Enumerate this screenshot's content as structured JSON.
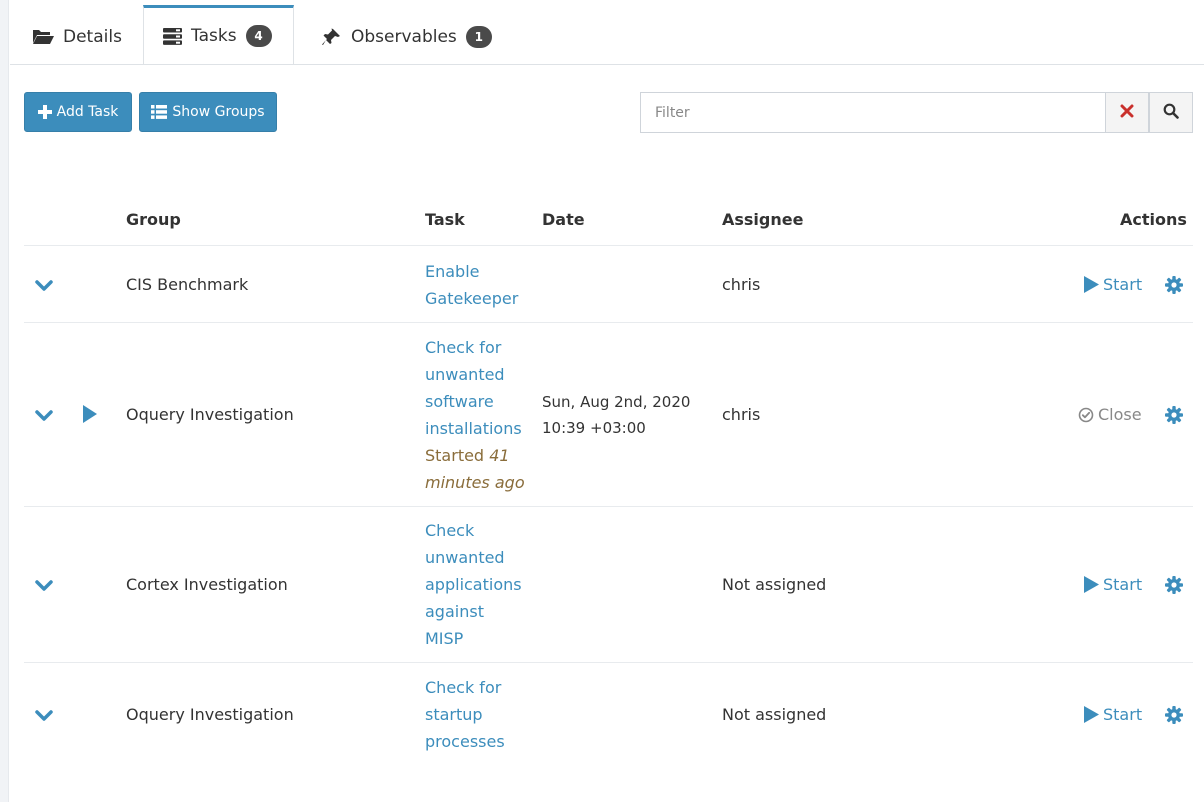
{
  "tabs": [
    {
      "label": "Details",
      "icon": "folder-open-icon"
    },
    {
      "label": "Tasks",
      "icon": "tasks-icon",
      "badge": "4",
      "active": true
    },
    {
      "label": "Observables",
      "icon": "thumbtack-icon",
      "badge": "1"
    }
  ],
  "toolbar": {
    "add_task": "Add Task",
    "show_groups": "Show Groups",
    "filter_placeholder": "Filter",
    "clear_icon": "times-icon",
    "search_icon": "search-icon"
  },
  "table": {
    "headers": {
      "group": "Group",
      "task": "Task",
      "date": "Date",
      "assignee": "Assignee",
      "actions": "Actions"
    },
    "rows": [
      {
        "group": "CIS Benchmark",
        "task_lines": [
          "Enable",
          "Gatekeeper"
        ],
        "date_lines": [],
        "assignee": "chris",
        "action": "Start"
      },
      {
        "group": "Oquery Investigation",
        "task_lines": [
          "Check for",
          "unwanted",
          "software",
          "installations"
        ],
        "status": "Started",
        "status_time_lines": [
          "41",
          "minutes ago"
        ],
        "date_lines": [
          "Sun, Aug 2nd, 2020",
          "10:39 +03:00"
        ],
        "assignee": "chris",
        "action": "Close"
      },
      {
        "group": "Cortex Investigation",
        "task_lines": [
          "Check",
          "unwanted",
          "applications",
          "against",
          "MISP"
        ],
        "date_lines": [],
        "assignee": "Not assigned",
        "action": "Start"
      },
      {
        "group": "Oquery Investigation",
        "task_lines": [
          "Check for",
          "startup",
          "processes"
        ],
        "date_lines": [],
        "assignee": "Not assigned",
        "action": "Start"
      }
    ]
  },
  "colors": {
    "primary": "#3c8dbc",
    "badge": "#4a4a4a",
    "started": "#8a6d3b",
    "clear": "#c9302c",
    "muted": "#888888"
  }
}
